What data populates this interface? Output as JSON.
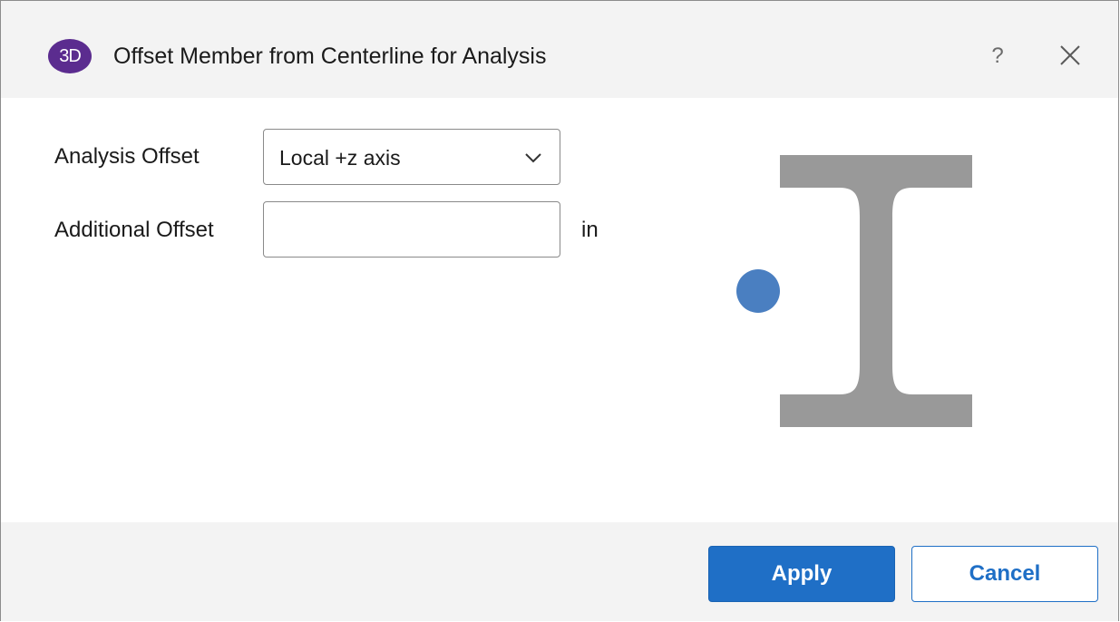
{
  "dialog": {
    "app_badge": "3D",
    "title": "Offset Member from Centerline for Analysis",
    "help_label": "?",
    "close_icon": "close-icon"
  },
  "form": {
    "analysis_offset_label": "Analysis Offset",
    "analysis_offset_value": "Local +z axis",
    "additional_offset_label": "Additional Offset",
    "additional_offset_value": "",
    "additional_offset_unit": "in"
  },
  "graphic": {
    "section_icon": "i-beam-section-icon",
    "offset_point_icon": "offset-point-icon",
    "beam_color": "#999999",
    "point_color": "#4a7fc1"
  },
  "footer": {
    "apply_label": "Apply",
    "cancel_label": "Cancel"
  },
  "colors": {
    "accent": "#1f6fc6",
    "badge": "#5b2c8f",
    "titlebar_bg": "#f3f3f3"
  }
}
